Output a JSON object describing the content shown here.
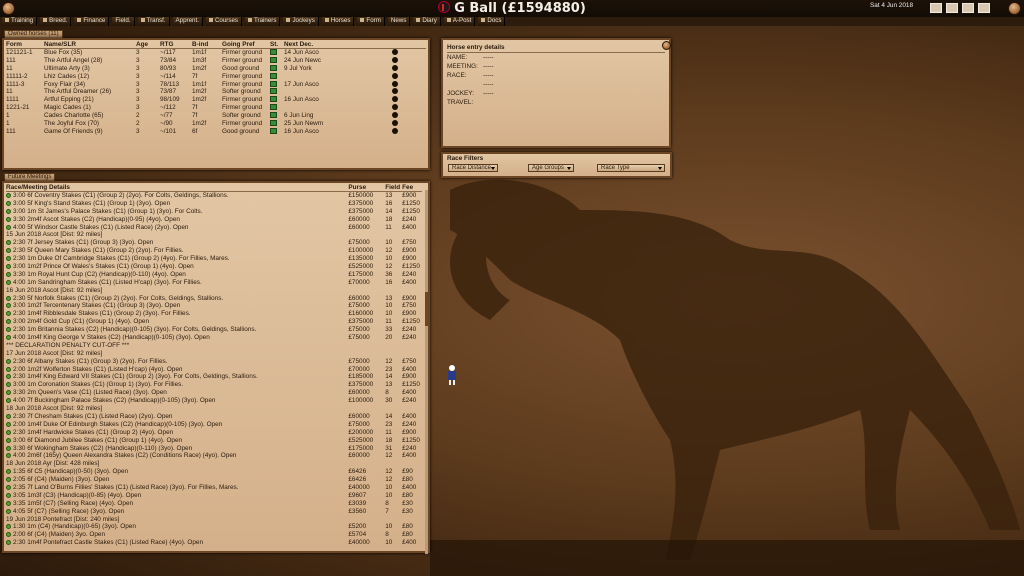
{
  "app": {
    "title": "G Ball",
    "balance": "(£1594880)",
    "date": "Sat 4 Jun 2018"
  },
  "nav": [
    "Training",
    "Breed.",
    "Finance",
    "Field.",
    "Transf.",
    "Apprent.",
    "Courses",
    "Trainers",
    "Jockeys",
    "Horses",
    "Form",
    "News",
    "Diary",
    "A-Post",
    "Docs"
  ],
  "owned": {
    "tab": "Owned horses (11)",
    "cols": [
      "Form",
      "Name/SLR",
      "Age",
      "RTG",
      "B-ind",
      "Going Pref",
      "St.",
      "Next Dec."
    ],
    "rows": [
      [
        "121121-1",
        "Blue Fox (35)",
        "3",
        "~/117",
        "1m1f",
        "Firmer ground",
        "14 Jun Asco"
      ],
      [
        "111",
        "The Artful Angel (28)",
        "3",
        "73/84",
        "1m3f",
        "Firmer ground",
        "24 Jun Newc"
      ],
      [
        "11",
        "Ultimate Arty (3)",
        "3",
        "80/93",
        "1m2f",
        "Good ground",
        "9 Jul York"
      ],
      [
        "11111-2",
        "Lhiz Cades (12)",
        "3",
        "~/114",
        "7f",
        "Firmer ground",
        ""
      ],
      [
        "1111-3",
        "Foxy Flair (34)",
        "3",
        "78/113",
        "1m1f",
        "Firmer ground",
        "17 Jun Asco"
      ],
      [
        "11",
        "The Artful Dreamer (26)",
        "3",
        "73/87",
        "1m2f",
        "Softer ground",
        ""
      ],
      [
        "1111",
        "Artful Epping (21)",
        "3",
        "98/109",
        "1m2f",
        "Firmer ground",
        "16 Jun Asco"
      ],
      [
        "1221-21",
        "Magic Cades (1)",
        "3",
        "~/112",
        "7f",
        "Firmer ground",
        ""
      ],
      [
        "1",
        "Cades Charlotte (65)",
        "2",
        "~/77",
        "7f",
        "Softer ground",
        "6 Jun Ling"
      ],
      [
        "1",
        "The Joyful Fox (70)",
        "2",
        "~/90",
        "1m2f",
        "Firmer ground",
        "25 Jun Newm"
      ],
      [
        "111",
        "Game Of Friends (9)",
        "3",
        "~/101",
        "6f",
        "Good ground",
        "16 Jun Asco"
      ]
    ]
  },
  "entry": {
    "tab": "Horse entry details",
    "fields": [
      [
        "NAME:",
        "-----"
      ],
      [
        "MEETING:",
        "-----"
      ],
      [
        "RACE:",
        "-----"
      ],
      [
        "",
        "-----"
      ],
      [
        "JOCKEY:",
        "-----"
      ],
      [
        "TRAVEL:",
        ""
      ]
    ]
  },
  "filters": {
    "tab": "Race Filters",
    "distance": "Race Distance",
    "age": "Age Groups",
    "type": "Race Type"
  },
  "future": {
    "tab": "Future Meetings",
    "cols": [
      "Race/Meeting Details",
      "Purse",
      "Field",
      "Fee"
    ],
    "rows": [
      [
        "r",
        "3:00 6f Coventry Stakes (C1) (Group 2) (2yo).  For Colts, Geldings, Stallions.",
        "£150000",
        "13",
        "£900"
      ],
      [
        "r",
        "3:00 5f King's Stand Stakes (C1) (Group 1) (3yo).  Open",
        "£375000",
        "16",
        "£1250"
      ],
      [
        "r",
        "3:00 1m St James's Palace Stakes (C1) (Group 1) (3yo).  For Colts.",
        "£375000",
        "14",
        "£1250"
      ],
      [
        "r",
        "3:30 2m4f Ascot Stakes (C2) (Handicap)(0-95) (4yo).  Open",
        "£60000",
        "18",
        "£240"
      ],
      [
        "r",
        "4:00 5f Windsor Castle Stakes (C1) (Listed Race) (2yo).  Open",
        "£60000",
        "11",
        "£400"
      ],
      [
        "m",
        "15 Jun 2018     Ascot     [Dist: 92 miles]"
      ],
      [
        "r",
        "2:30 7f Jersey Stakes (C1) (Group 3) (3yo).  Open",
        "£75000",
        "10",
        "£750"
      ],
      [
        "r",
        "2:30 5f Queen Mary Stakes (C1) (Group 2) (2yo).  For Fillies.",
        "£100000",
        "12",
        "£900"
      ],
      [
        "r",
        "2:30 1m Duke Of Cambridge Stakes (C1) (Group 2) (4yo).  For Fillies, Mares.",
        "£135000",
        "10",
        "£900"
      ],
      [
        "r",
        "3:00 1m2f Prince Of Wales's Stakes (C1) (Group 1) (4yo).  Open",
        "£525000",
        "12",
        "£1250"
      ],
      [
        "r",
        "3:30 1m Royal Hunt Cup (C2) (Handicap)(0-110) (4yo).  Open",
        "£175000",
        "36",
        "£240"
      ],
      [
        "r",
        "4:00 1m Sandringham Stakes (C1) (Listed H'cap) (3yo).  For Fillies.",
        "£70000",
        "16",
        "£400"
      ],
      [
        "m",
        "16 Jun 2018     Ascot     [Dist: 92 miles]"
      ],
      [
        "r",
        "2:30 5f Norfolk Stakes (C1) (Group 2) (2yo).  For Colts, Geldings, Stallions.",
        "£60000",
        "13",
        "£900"
      ],
      [
        "r",
        "3:00 1m2f Tercentenary Stakes (C1) (Group 3) (3yo).  Open",
        "£75000",
        "10",
        "£750"
      ],
      [
        "r",
        "2:30 1m4f Ribblesdale Stakes (C1) (Group 2) (3yo).  For Fillies.",
        "£160000",
        "10",
        "£900"
      ],
      [
        "r",
        "3:00 2m4f Gold Cup (C1) (Group 1) (4yo).  Open",
        "£375000",
        "11",
        "£1250"
      ],
      [
        "r",
        "2:30 1m Britannia Stakes (C2) (Handicap)(0-105) (3yo).  For Colts, Geldings, Stallions.",
        "£75000",
        "33",
        "£240"
      ],
      [
        "r",
        "4:00 1m4f King George V Stakes (C2) (Handicap)(0-105) (3yo).  Open",
        "£75000",
        "20",
        "£240"
      ],
      [
        "m",
        "*** DECLARATION PENALTY CUT-OFF ***"
      ],
      [
        "m",
        "17 Jun 2018     Ascot     [Dist: 92 miles]"
      ],
      [
        "r",
        "2:30 6f Albany Stakes (C1) (Group 3) (2yo).  For Fillies.",
        "£75000",
        "12",
        "£750"
      ],
      [
        "r",
        "2:00 1m2f Wolferton Stakes (C1) (Listed H'cap) (4yo).  Open",
        "£70000",
        "23",
        "£400"
      ],
      [
        "r",
        "2:30 1m4f King Edward VII Stakes (C1) (Group 2) (3yo).  For Colts, Geldings, Stallions.",
        "£185000",
        "14",
        "£900"
      ],
      [
        "r",
        "3:00 1m Coronation Stakes (C1) (Group 1) (3yo).  For Fillies.",
        "£375000",
        "13",
        "£1250"
      ],
      [
        "r",
        "3:30 2m Queen's Vase (C1) (Listed Race) (3yo).  Open",
        "£60000",
        "8",
        "£400"
      ],
      [
        "r",
        "4:00 7f Buckingham Palace Stakes (C2) (Handicap)(0-105) (3yo).  Open",
        "£100000",
        "30",
        "£240"
      ],
      [
        "m",
        "18 Jun 2018     Ascot     [Dist: 92 miles]"
      ],
      [
        "r",
        "2:30 7f Chesham Stakes (C1) (Listed Race) (2yo).  Open",
        "£60000",
        "14",
        "£400"
      ],
      [
        "r",
        "2:00 1m4f Duke Of Edinburgh Stakes (C2) (Handicap)(0-105) (3yo).  Open",
        "£75000",
        "23",
        "£240"
      ],
      [
        "r",
        "2:30 1m4f Hardwicke Stakes (C1) (Group 2) (4yo).  Open",
        "£200000",
        "11",
        "£900"
      ],
      [
        "r",
        "3:00 6f Diamond Jubilee Stakes (C1) (Group 1) (4yo).  Open",
        "£525000",
        "18",
        "£1250"
      ],
      [
        "r",
        "3:30 6f Wokingham Stakes (C2) (Handicap)(0-110) (3yo).  Open",
        "£175000",
        "31",
        "£240"
      ],
      [
        "r",
        "4:00 2m6f (165y) Queen Alexandra Stakes (C2) (Conditions Race) (4yo).  Open",
        "£60000",
        "12",
        "£400"
      ],
      [
        "m",
        "18 Jun 2018     Ayr     [Dist: 428 miles]"
      ],
      [
        "r",
        "1:35 6f C5 (Handicap)(0-50) (3yo).  Open",
        "£6426",
        "12",
        "£90"
      ],
      [
        "r",
        "2:05 6f (C4) (Maiden) (3yo).  Open",
        "£6426",
        "12",
        "£80"
      ],
      [
        "r",
        "2:35 7f Land O'Burns Fillies' Stakes (C1) (Listed Race) (3yo).  For Fillies, Mares.",
        "£40000",
        "10",
        "£400"
      ],
      [
        "r",
        "3:05 1m3f (C3) (Handicap)(0-85) (4yo).  Open",
        "£9607",
        "10",
        "£80"
      ],
      [
        "r",
        "3:35 1m5f (C7) (Selling Race) (4yo).  Open",
        "£3039",
        "8",
        "£30"
      ],
      [
        "r",
        "4:05 5f (C7) (Selling Race) (3yo).  Open",
        "£3560",
        "7",
        "£30"
      ],
      [
        "m",
        "19 Jun 2018     Pontefract     [Dist: 240 miles]"
      ],
      [
        "r",
        "1:30 1m (C4) (Handicap)(0-65) (3yo).  Open",
        "£5200",
        "10",
        "£80"
      ],
      [
        "r",
        "2:00 6f (C4) (Maiden) 3yo.  Open",
        "£5704",
        "8",
        "£80"
      ],
      [
        "r",
        "2:30 1m4f Pontefract Castle Stakes (C1) (Listed Race) (4yo).  Open",
        "£40000",
        "10",
        "£400"
      ]
    ]
  }
}
